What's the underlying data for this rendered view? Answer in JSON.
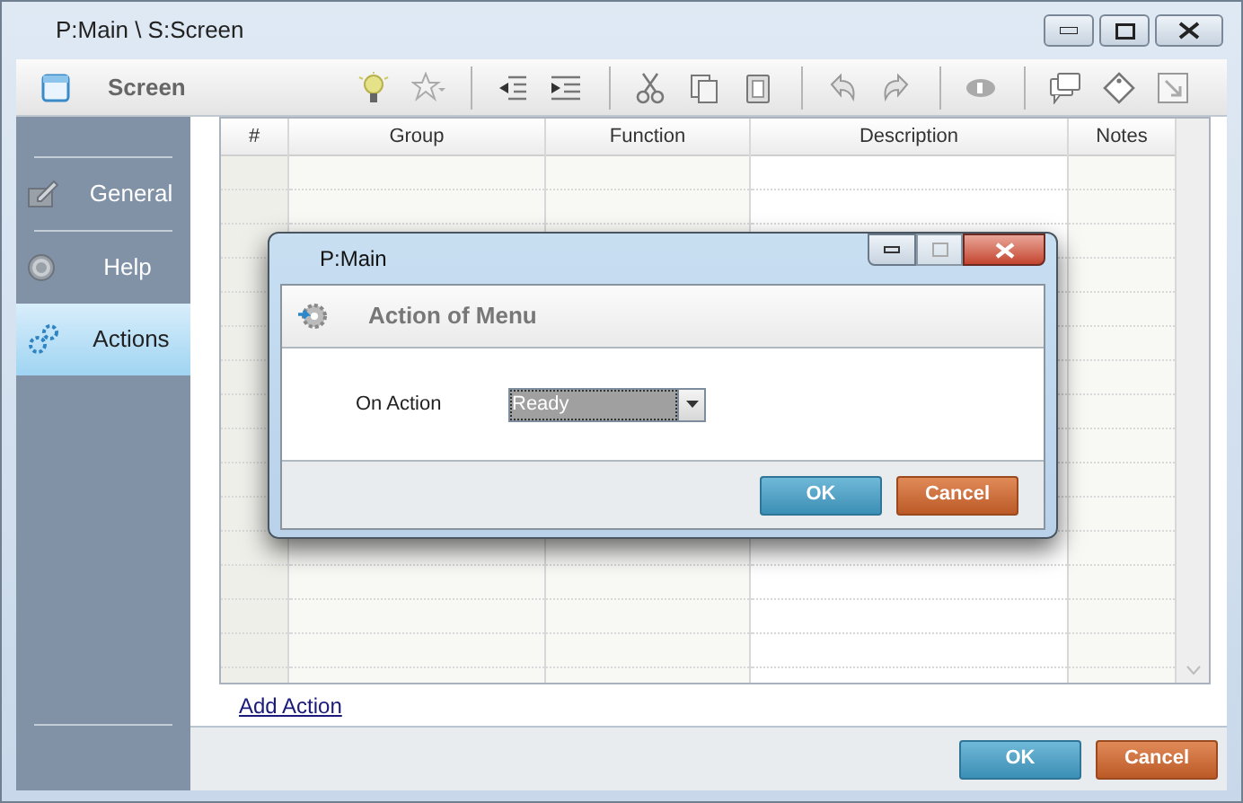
{
  "window": {
    "title": "P:Main \\ S:Screen"
  },
  "toolbar": {
    "title": "Screen"
  },
  "sidebar": {
    "items": [
      {
        "label": "General",
        "selected": false
      },
      {
        "label": "Help",
        "selected": false
      },
      {
        "label": "Actions",
        "selected": true
      }
    ]
  },
  "table": {
    "columns": [
      "#",
      "Group",
      "Function",
      "Description",
      "Notes"
    ]
  },
  "link": "Add Action",
  "buttons": [
    {
      "label": "OK",
      "kind": "primary"
    },
    {
      "label": "Cancel",
      "kind": "cancel"
    }
  ],
  "dialog": {
    "title": "P:Main",
    "header": "Action of Menu",
    "field": {
      "label": "On Action",
      "value": "Ready"
    },
    "buttons": [
      {
        "label": "OK",
        "kind": "primary"
      },
      {
        "label": "Cancel",
        "kind": "cancel"
      }
    ]
  }
}
